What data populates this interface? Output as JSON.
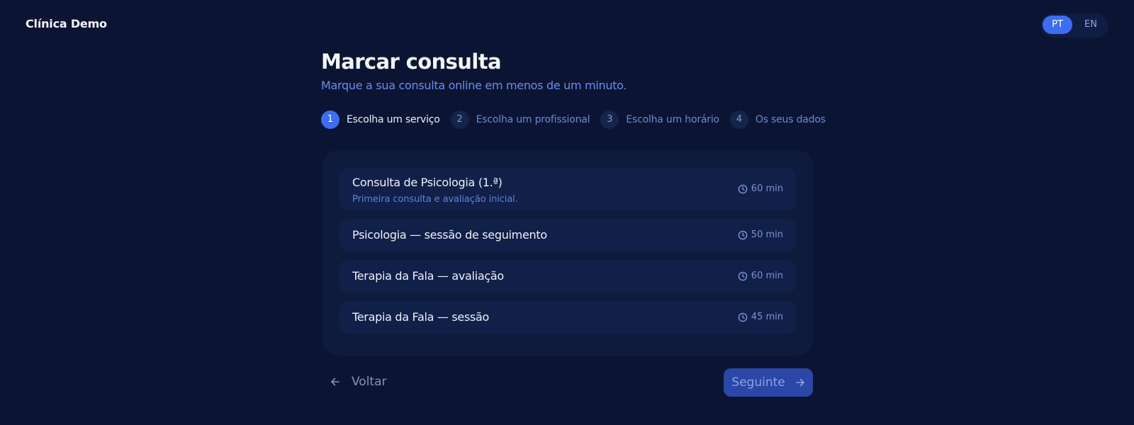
{
  "brand": {
    "name": "Clínica Demo"
  },
  "language": {
    "options": [
      "PT",
      "EN"
    ],
    "selected": "PT"
  },
  "header": {
    "title": "Marcar consulta",
    "subtitle": "Marque a sua consulta online em menos de um minuto."
  },
  "steps": [
    {
      "number": "1",
      "label": "Escolha um serviço",
      "active": true
    },
    {
      "number": "2",
      "label": "Escolha um profissional",
      "active": false
    },
    {
      "number": "3",
      "label": "Escolha um horário",
      "active": false
    },
    {
      "number": "4",
      "label": "Os seus dados",
      "active": false
    }
  ],
  "services": [
    {
      "name": "Consulta de Psicologia (1.ª)",
      "description": "Primeira consulta e avaliação inicial.",
      "duration": "60 min",
      "icon": "clock-icon"
    },
    {
      "name": "Psicologia — sessão de seguimento",
      "duration": "50 min",
      "icon": "clock-icon"
    },
    {
      "name": "Terapia da Fala — avaliação",
      "duration": "60 min",
      "icon": "clock-icon"
    },
    {
      "name": "Terapia da Fala — sessão",
      "duration": "45 min",
      "icon": "clock-icon"
    }
  ],
  "navigation": {
    "back_label": "Voltar",
    "back_icon": "arrow-left-icon",
    "next_label": "Seguinte",
    "next_icon": "arrow-right-icon"
  },
  "colors": {
    "background": "#0b1533",
    "accent": "#3d6df2",
    "panel": "#0e1b3d",
    "card": "#112048",
    "next_button": "#2b47a8"
  }
}
